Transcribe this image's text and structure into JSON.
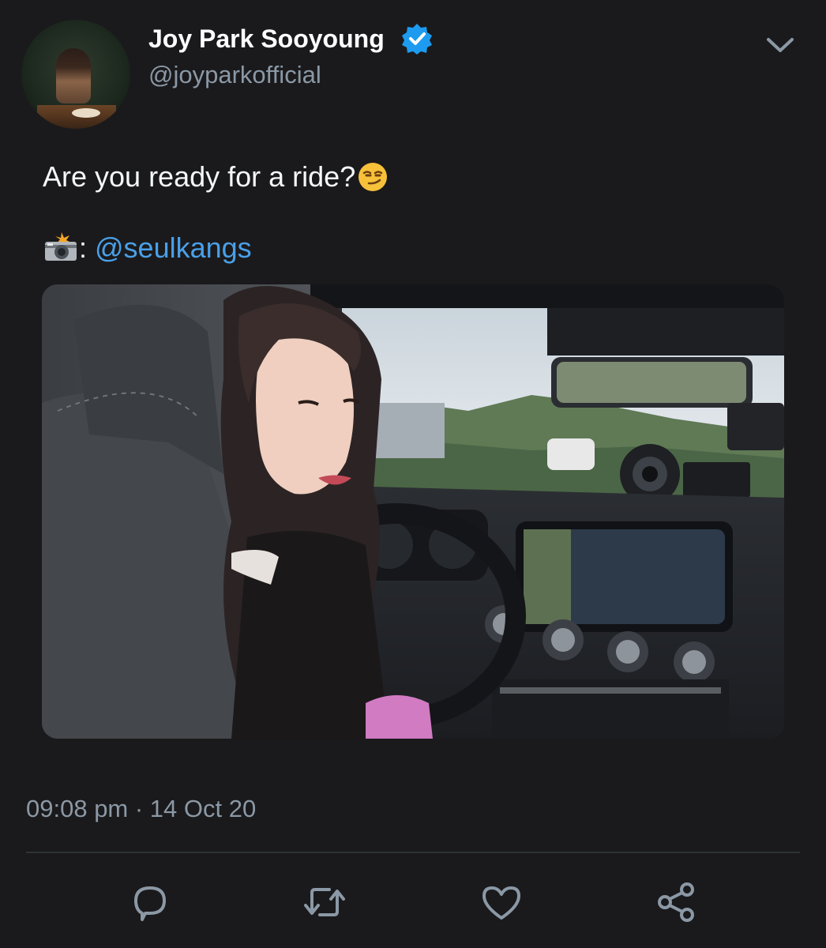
{
  "author": {
    "display_name": "Joy Park Sooyoung",
    "handle": "@joyparkofficial",
    "verified": true,
    "avatar_icon": "profile-photo"
  },
  "tweet": {
    "line1_text": "Are you ready for a ride?",
    "line1_emoji": "smirking-face-emoji",
    "line2_prefix": ": ",
    "line2_emoji": "camera-with-flash-emoji",
    "mention": "@seulkangs",
    "media_icon": "photo-image"
  },
  "meta": {
    "timestamp": "09:08 pm · 14 Oct 20"
  },
  "actions": {
    "reply_icon": "reply-icon",
    "retweet_icon": "retweet-icon",
    "like_icon": "heart-icon",
    "share_icon": "share-icon"
  },
  "colors": {
    "background": "#1a1a1c",
    "text_secondary": "#8b98a5",
    "link": "#4aa0e8",
    "verified_blue": "#1d9bf0",
    "icon_color": "#8b98a5"
  }
}
